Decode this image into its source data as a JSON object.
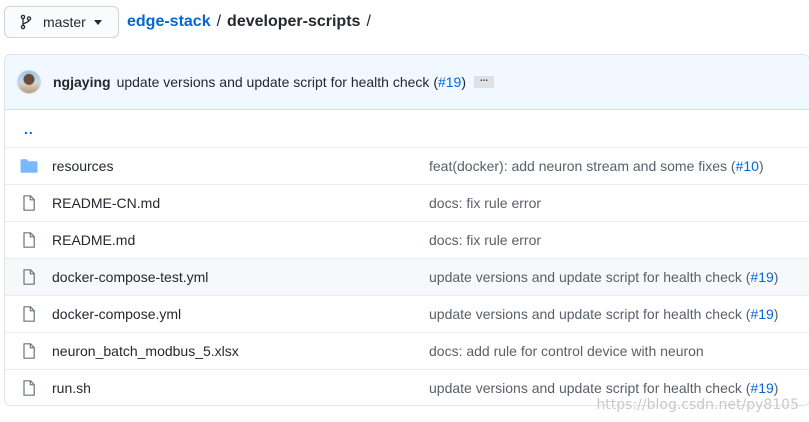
{
  "branch": {
    "label": "master"
  },
  "breadcrumb": {
    "repo": "edge-stack",
    "sep1": "/",
    "dir": "developer-scripts",
    "sep2": "/"
  },
  "latest_commit": {
    "author": "ngjaying",
    "message": "update versions and update script for health check (",
    "pr": "#19",
    "close": ")",
    "ellipsis": "..."
  },
  "parent_link": "..",
  "files": [
    {
      "type": "folder",
      "name": "resources",
      "message": "feat(docker): add neuron stream and some fixes (",
      "pr": "#10",
      "close": ")"
    },
    {
      "type": "file",
      "name": "README-CN.md",
      "message": "docs: fix rule error",
      "pr": "",
      "close": ""
    },
    {
      "type": "file",
      "name": "README.md",
      "message": "docs: fix rule error",
      "pr": "",
      "close": ""
    },
    {
      "type": "file",
      "name": "docker-compose-test.yml",
      "message": "update versions and update script for health check (",
      "pr": "#19",
      "close": ")"
    },
    {
      "type": "file",
      "name": "docker-compose.yml",
      "message": "update versions and update script for health check (",
      "pr": "#19",
      "close": ")"
    },
    {
      "type": "file",
      "name": "neuron_batch_modbus_5.xlsx",
      "message": "docs: add rule for control device with neuron",
      "pr": "",
      "close": ""
    },
    {
      "type": "file",
      "name": "run.sh",
      "message": "update versions and update script for health check (",
      "pr": "#19",
      "close": ")"
    }
  ],
  "watermark": "https://blog.csdn.net/py8105",
  "colors": {
    "link": "#0366d6",
    "folder": "#79b8ff",
    "file_icon": "#6a737d",
    "commit_bar": "#f1f8ff"
  }
}
